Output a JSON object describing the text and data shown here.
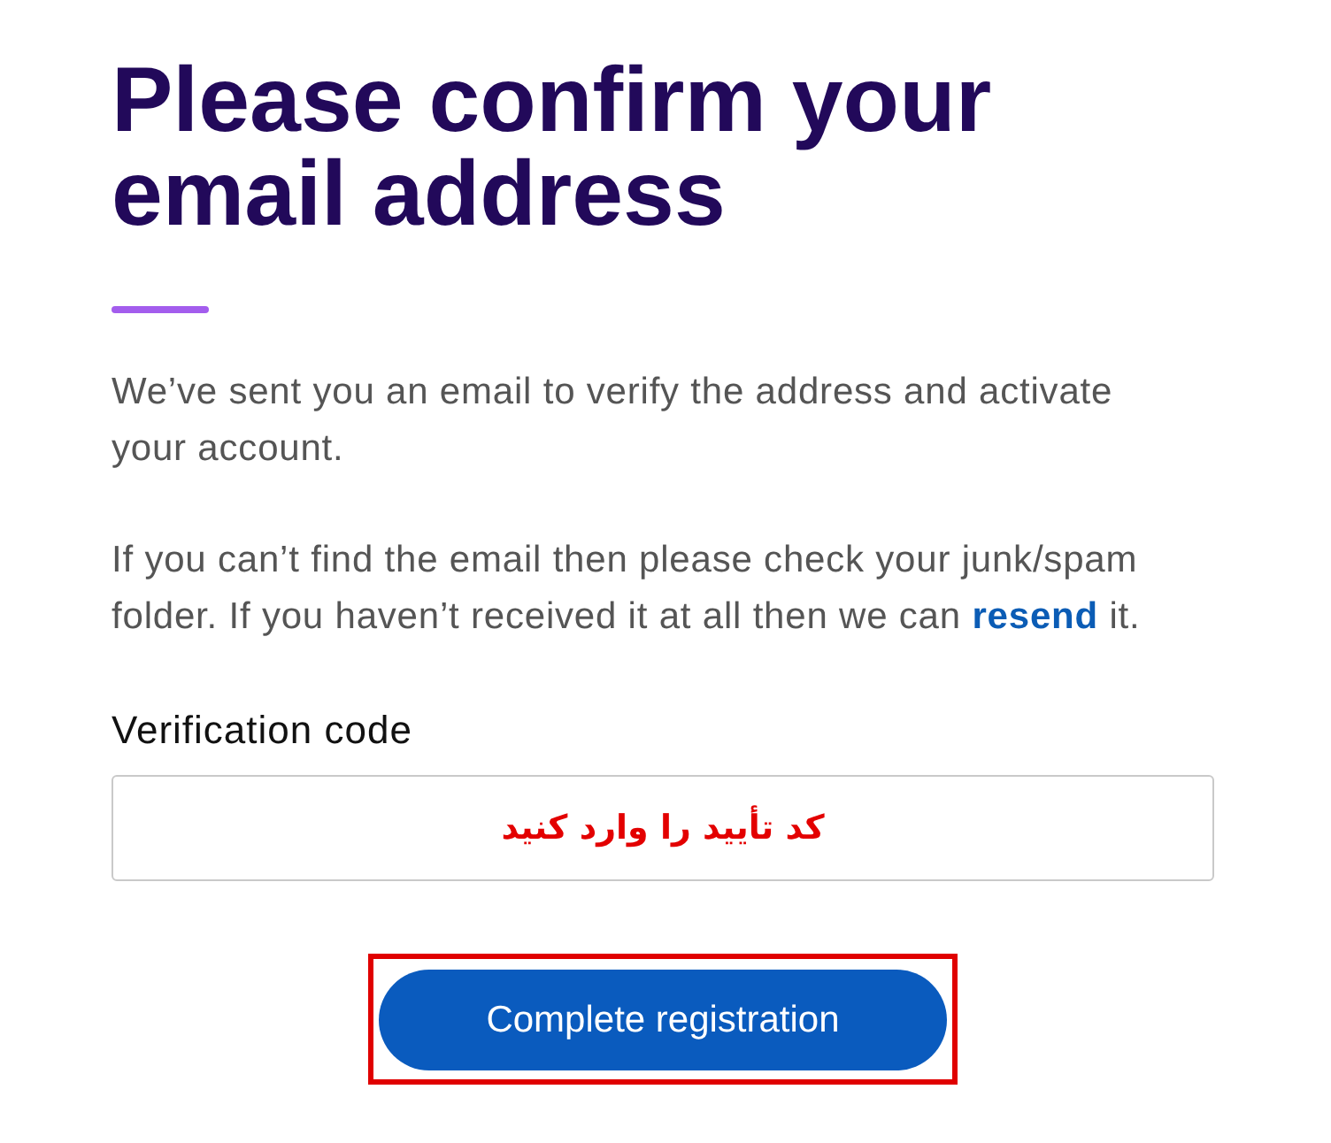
{
  "heading": {
    "title": "Please confirm your email address"
  },
  "paragraphs": [
    {
      "segments": [
        {
          "kind": "text",
          "text": "We’ve sent you an email to verify the address and activate your account."
        }
      ]
    },
    {
      "segments": [
        {
          "kind": "text",
          "text": "If you can’t find the email then please check your junk/spam folder. If you haven’t received it at all then we can "
        },
        {
          "kind": "link",
          "text": "resend"
        },
        {
          "kind": "text",
          "text": " it."
        }
      ]
    }
  ],
  "verification_field": {
    "label": "Verification code",
    "annotation": "کد تأیید را وارد کنید"
  },
  "submit_button": {
    "label": "Complete registration",
    "highlighted": true
  }
}
